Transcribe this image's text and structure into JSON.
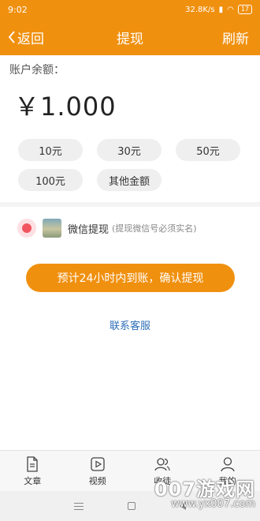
{
  "status_bar": {
    "time": "9:02",
    "speed": "32.8K/s",
    "battery": "17"
  },
  "nav": {
    "back_label": "返回",
    "title": "提现",
    "refresh_label": "刷新"
  },
  "balance": {
    "label": "账户余额：",
    "amount": "￥1.000"
  },
  "amount_options": [
    "10元",
    "30元",
    "50元",
    "100元",
    "其他金额"
  ],
  "withdraw_method": {
    "label": "微信提现",
    "note": "(提现微信号必须实名)"
  },
  "confirm_button": "预计24小时内到账，确认提现",
  "service_link": "联系客服",
  "tabs": [
    {
      "label": "文章",
      "icon": "document-icon"
    },
    {
      "label": "视频",
      "icon": "video-icon"
    },
    {
      "label": "收徒",
      "icon": "users-icon"
    },
    {
      "label": "我的",
      "icon": "user-icon"
    }
  ],
  "watermark": {
    "main": "007游戏网",
    "sub": "www.yx007.com"
  },
  "colors": {
    "accent": "#f0900f",
    "link": "#2f6fb8",
    "radio": "#f2555f"
  }
}
